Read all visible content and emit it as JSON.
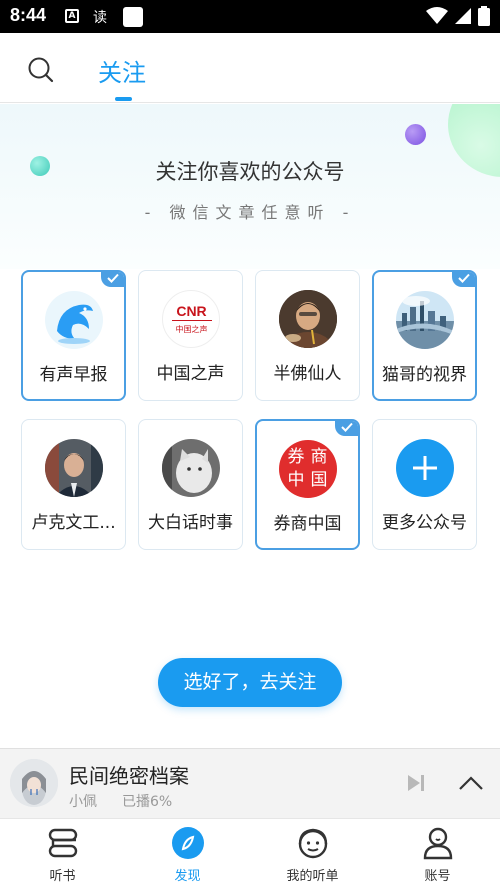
{
  "status_bar": {
    "time": "8:44",
    "notification_a": "A",
    "notification_text": "读"
  },
  "top_nav": {
    "tab_label": "关注"
  },
  "hero": {
    "title": "关注你喜欢的公众号",
    "subtitle": "- 微信文章任意听 -"
  },
  "accounts": [
    {
      "name": "有声早报",
      "selected": true,
      "icon": "dolphin-logo-icon"
    },
    {
      "name": "中国之声",
      "selected": false,
      "icon": "cnr-logo-icon",
      "logo_text": "CNR",
      "logo_sub": "中国之声"
    },
    {
      "name": "半佛仙人",
      "selected": false,
      "icon": "person-avatar"
    },
    {
      "name": "猫哥的视界",
      "selected": true,
      "icon": "city-avatar"
    },
    {
      "name": "卢克文工...",
      "selected": false,
      "icon": "person-avatar"
    },
    {
      "name": "大白话时事",
      "selected": false,
      "icon": "cat-avatar"
    },
    {
      "name": "券商中国",
      "selected": true,
      "icon": "seal-logo-icon",
      "logo_chars": [
        "券",
        "商",
        "中",
        "国"
      ]
    },
    {
      "name": "更多公众号",
      "selected": false,
      "icon": "plus-icon"
    }
  ],
  "follow_button": {
    "label": "选好了，去关注"
  },
  "player": {
    "title": "民间绝密档案",
    "author": "小佩",
    "progress": "已播6%"
  },
  "bottom_nav": [
    {
      "label": "听书",
      "active": false
    },
    {
      "label": "发现",
      "active": true
    },
    {
      "label": "我的听单",
      "active": false
    },
    {
      "label": "账号",
      "active": false
    }
  ],
  "colors": {
    "accent": "#1a9bf0",
    "selected_border": "#4b9fe3"
  }
}
